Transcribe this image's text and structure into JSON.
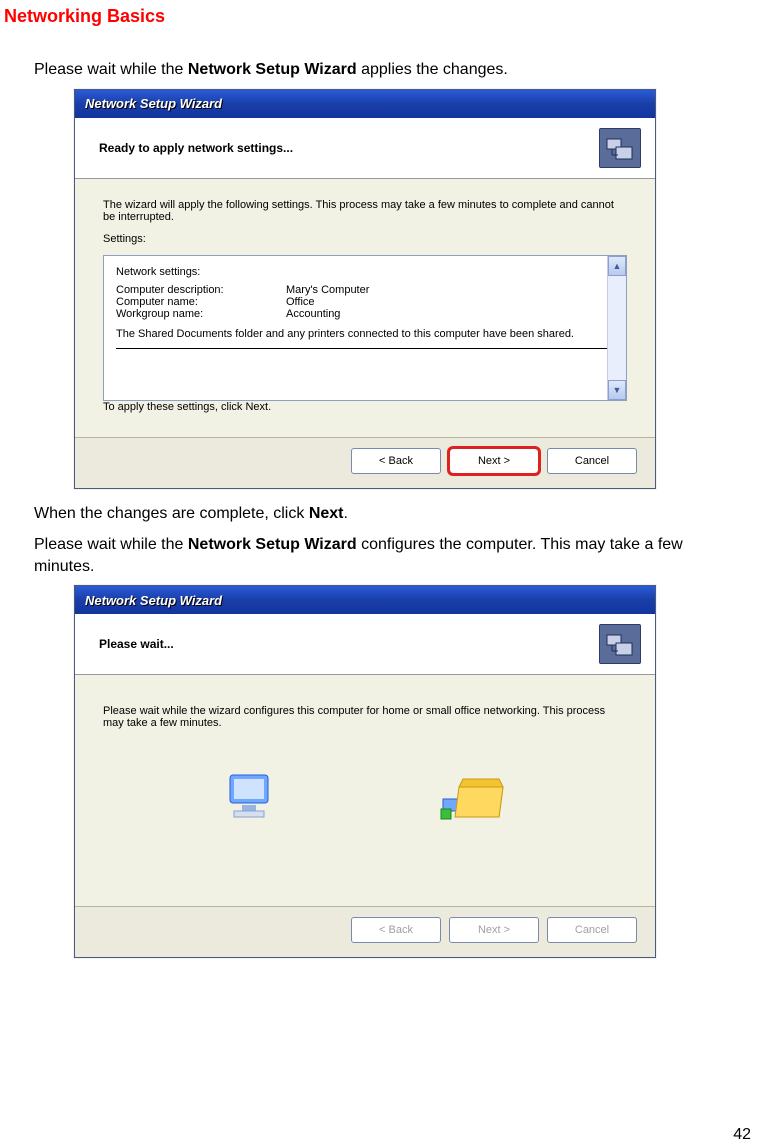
{
  "page": {
    "heading": "Networking Basics",
    "intro_pre": "Please wait while the ",
    "intro_bold": "Network Setup Wizard",
    "intro_post": " applies the changes.",
    "mid1": "When the changes are complete, click ",
    "mid1_bold": "Next",
    "mid1_post": ".",
    "mid2_pre": "Please wait while the ",
    "mid2_bold": "Network Setup Wizard",
    "mid2_post": " configures the computer. This may take a few minutes.",
    "page_number": "42"
  },
  "wizard1": {
    "title": "Network Setup Wizard",
    "header": "Ready to apply network settings...",
    "desc": "The wizard will apply the following settings. This process may take a few minutes to complete and cannot be interrupted.",
    "settings_label": "Settings:",
    "box": {
      "heading": "Network settings:",
      "row1_label": "Computer description:",
      "row1_value": "Mary's Computer",
      "row2_label": "Computer name:",
      "row2_value": "Office",
      "row3_label": "Workgroup name:",
      "row3_value": "Accounting",
      "shared": "The Shared Documents folder and any printers connected to this computer have been shared."
    },
    "apply_note": "To apply these settings, click Next.",
    "buttons": {
      "back": "< Back",
      "next": "Next >",
      "cancel": "Cancel"
    }
  },
  "wizard2": {
    "title": "Network Setup Wizard",
    "header": "Please wait...",
    "desc": "Please wait while the wizard configures this computer for home or small office networking. This process may take a few minutes.",
    "buttons": {
      "back": "< Back",
      "next": "Next >",
      "cancel": "Cancel"
    }
  }
}
